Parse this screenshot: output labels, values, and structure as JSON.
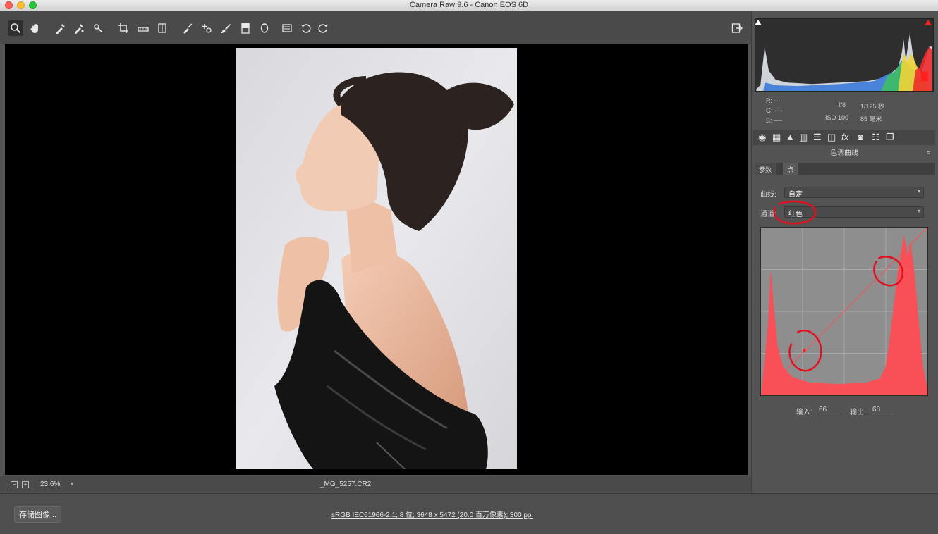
{
  "window": {
    "title": "Camera Raw 9.6 -  Canon EOS 6D"
  },
  "toolbar": {
    "tools": [
      "zoom-icon",
      "hand-icon",
      "white-balance-icon",
      "color-sampler-icon",
      "targeted-adjust-icon",
      "crop-icon",
      "straighten-icon",
      "transform-icon",
      "spot-removal-icon",
      "red-eye-icon",
      "adjustment-brush-icon",
      "graduated-filter-icon",
      "radial-filter-icon",
      "preferences-icon",
      "rotate-left-icon",
      "rotate-right-icon"
    ],
    "open_button_icon": "open-object-icon"
  },
  "status": {
    "zoom": "23.6%",
    "filename": "_MG_5257.CR2"
  },
  "bottom": {
    "save_button": "存储图像...",
    "workflow_link": "sRGB IEC61966-2.1; 8 位; 3648 x 5472 (20.0 百万像素); 300 ppi"
  },
  "info": {
    "r_label": "R:",
    "g_label": "G:",
    "b_label": "B:",
    "r_value": "----",
    "g_value": "----",
    "b_value": "----",
    "aperture": "f/8",
    "shutter": "1/125 秒",
    "iso": "ISO 100",
    "focal": "85 毫米"
  },
  "panel": {
    "title": "色调曲线",
    "tab_param": "参数",
    "tab_point": "点",
    "curve_label": "曲线:",
    "curve_value": "自定",
    "channel_label": "通道:",
    "channel_value": "红色",
    "input_label": "输入:",
    "input_value": "66",
    "output_label": "输出:",
    "output_value": "68"
  },
  "colors": {
    "accent_red": "#ff4d55",
    "annotation_red": "#e01020",
    "bg": "#535353"
  }
}
